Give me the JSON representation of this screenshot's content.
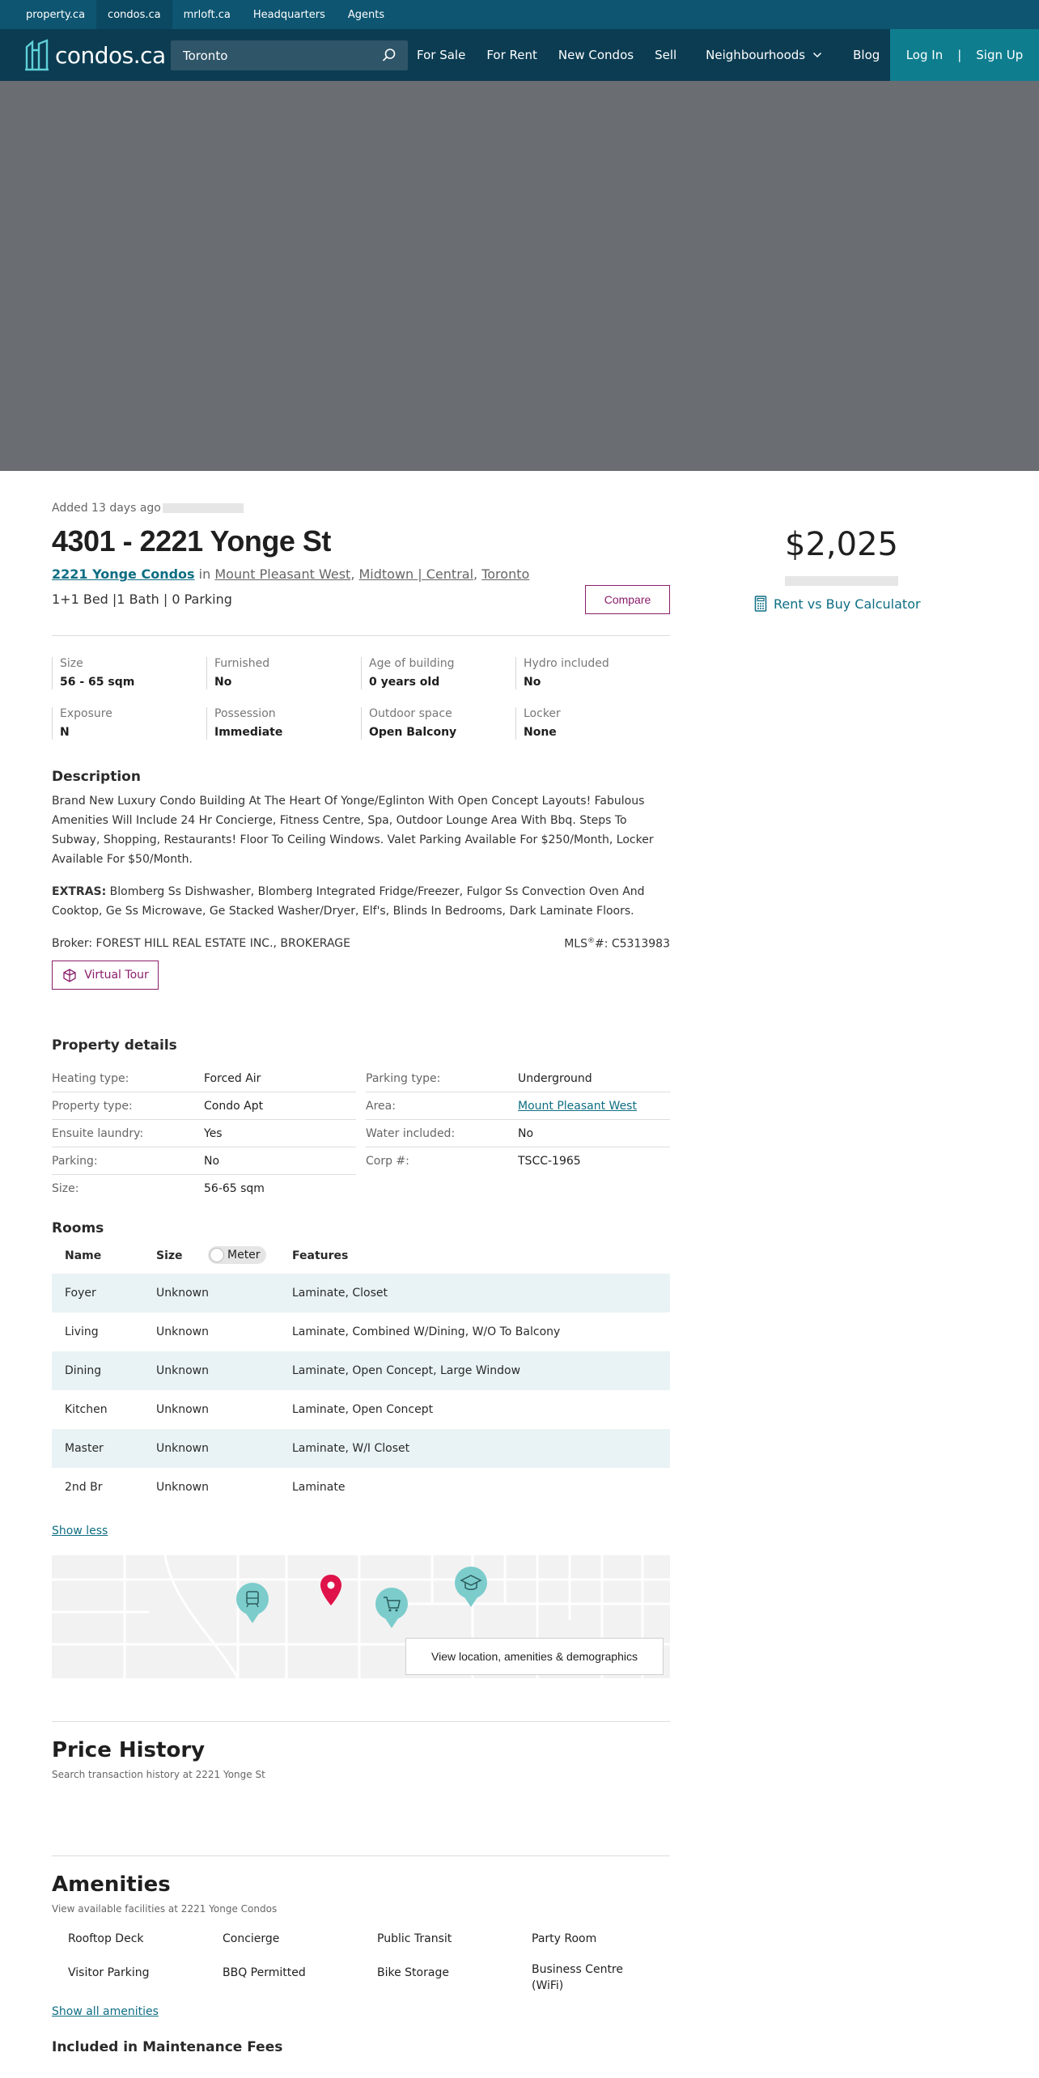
{
  "topbar": {
    "links": [
      "property.ca",
      "condos.ca",
      "mrloft.ca",
      "Headquarters",
      "Agents"
    ],
    "active": "condos.ca"
  },
  "header": {
    "logo_text": "condos.ca",
    "search_value": "Toronto",
    "nav": [
      "For Sale",
      "For Rent",
      "New Condos",
      "Sell",
      "Neighbourhoods",
      "Blog"
    ],
    "login": "Log In",
    "signup": "Sign Up",
    "separator": "|",
    "accent": "#0e7e8f"
  },
  "listing": {
    "added": "Added 13 days ago",
    "title": "4301 - 2221 Yonge St",
    "building": "2221 Yonge Condos",
    "in": "in",
    "area1": "Mount Pleasant West",
    "area2": "Midtown | Central",
    "area3": "Toronto",
    "comma": ",",
    "specs": "1+1 Bed |1 Bath | 0 Parking",
    "compare": "Compare"
  },
  "price": {
    "value": "$2,025",
    "rvb": "Rent vs Buy Calculator"
  },
  "facts": [
    {
      "label": "Size",
      "value": "56 - 65 sqm"
    },
    {
      "label": "Furnished",
      "value": "No"
    },
    {
      "label": "Age of building",
      "value": "0 years old"
    },
    {
      "label": "Hydro included",
      "value": "No"
    },
    {
      "label": "Exposure",
      "value": "N"
    },
    {
      "label": "Possession",
      "value": "Immediate"
    },
    {
      "label": "Outdoor space",
      "value": "Open Balcony"
    },
    {
      "label": "Locker",
      "value": "None"
    }
  ],
  "description": {
    "heading": "Description",
    "text": "Brand New Luxury Condo Building At The Heart Of Yonge/Eglinton With Open Concept Layouts! Fabulous Amenities Will Include 24 Hr Concierge, Fitness Centre, Spa, Outdoor Lounge Area With Bbq. Steps To Subway, Shopping, Restaurants! Floor To Ceiling Windows. Valet Parking Available For $250/Month, Locker Available For $50/Month.",
    "extras_label": "EXTRAS:",
    "extras": "Blomberg Ss Dishwasher, Blomberg Integrated Fridge/Freezer, Fulgor Ss Convection Oven And Cooktop, Ge Ss Microwave, Ge Stacked Washer/Dryer, Elf's, Blinds In Bedrooms, Dark Laminate Floors.",
    "broker": "Broker: FOREST HILL REAL ESTATE INC., BROKERAGE",
    "mls_prefix": "MLS",
    "mls_sup": "®",
    "mls": "#: C5313983",
    "virtual_tour": "Virtual Tour"
  },
  "property_details": {
    "heading": "Property details",
    "left": [
      {
        "k": "Heating type:",
        "v": "Forced Air"
      },
      {
        "k": "Property type:",
        "v": "Condo Apt"
      },
      {
        "k": "Ensuite laundry:",
        "v": "Yes"
      },
      {
        "k": "Parking:",
        "v": "No"
      },
      {
        "k": "Size:",
        "v": "56-65 sqm"
      }
    ],
    "right": [
      {
        "k": "Parking type:",
        "v": "Underground"
      },
      {
        "k": "Area:",
        "v": "Mount Pleasant West"
      },
      {
        "k": "Water included:",
        "v": "No"
      },
      {
        "k": "Corp #:",
        "v": "TSCC-1965"
      }
    ]
  },
  "rooms": {
    "heading": "Rooms",
    "cols": [
      "Name",
      "Size",
      "Features"
    ],
    "toggle": "Meter",
    "rows": [
      [
        "Foyer",
        "Unknown",
        "Laminate, Closet"
      ],
      [
        "Living",
        "Unknown",
        "Laminate, Combined W/Dining, W/O To Balcony"
      ],
      [
        "Dining",
        "Unknown",
        "Laminate, Open Concept, Large Window"
      ],
      [
        "Kitchen",
        "Unknown",
        "Laminate, Open Concept"
      ],
      [
        "Master",
        "Unknown",
        "Laminate, W/I Closet"
      ],
      [
        "2nd Br",
        "Unknown",
        "Laminate"
      ]
    ],
    "show_less": "Show less"
  },
  "map": {
    "button": "View location, amenities & demographics"
  },
  "price_history": {
    "heading": "Price History",
    "sub": "Search transaction history at 2221 Yonge St"
  },
  "amenities": {
    "heading": "Amenities",
    "sub": "View available facilities at 2221 Yonge Condos",
    "items": [
      "Rooftop Deck",
      "Concierge",
      "Public Transit",
      "Party Room",
      "Visitor Parking",
      "BBQ Permitted",
      "Bike Storage",
      "Business Centre (WiFi)"
    ],
    "show_all": "Show all amenities"
  },
  "maintenance": {
    "heading": "Included in Maintenance Fees"
  }
}
